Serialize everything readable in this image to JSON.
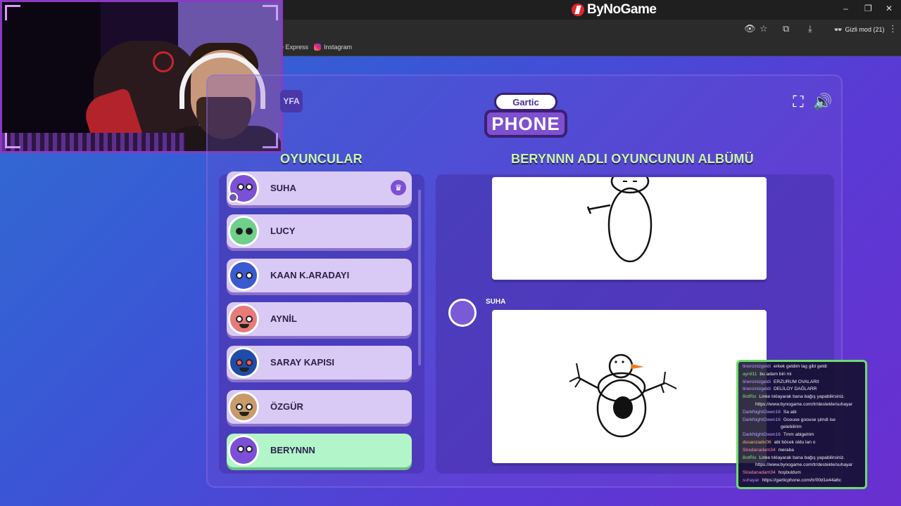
{
  "browser": {
    "brand": "ByNoGame",
    "incognito_label": "Gizli mod (21)",
    "bookmarks": [
      "e Express",
      "Instagram"
    ],
    "window_controls": [
      "–",
      "❐",
      "✕"
    ]
  },
  "game": {
    "left_button": "YFA",
    "logo_top": "Gartic",
    "logo_bottom": "PHONE",
    "players_title": "OYUNCULAR",
    "album_title": "BERYNNN ADLI OYUNCUNUN ALBÜMÜ",
    "players": [
      {
        "name": "SUHA",
        "avatar_color": "#7b4fd6",
        "host": true
      },
      {
        "name": "LUCY",
        "avatar_color": "#6fd08a",
        "host": false
      },
      {
        "name": "KAAN K.ARADAYI",
        "avatar_color": "#3a5ad0",
        "host": false
      },
      {
        "name": "AYNİL",
        "avatar_color": "#e87a7a",
        "host": false
      },
      {
        "name": "SARAY KAPISI",
        "avatar_color": "#1f4ca8",
        "host": false
      },
      {
        "name": "ÖZGÜR",
        "avatar_color": "#c99a6a",
        "host": false
      },
      {
        "name": "BERYNNN",
        "avatar_color": "#7b4fd6",
        "host": false,
        "active": true
      }
    ],
    "album_entry_author": "SUHA"
  },
  "chat": {
    "lines": [
      {
        "user": "tinercinizgeldi",
        "text": "erkek geldim lag gibi geldi",
        "color": "#b9a0ff"
      },
      {
        "user": "aynil11",
        "text": "bu adam biri mi",
        "color": "#7de07d"
      },
      {
        "user": "tinercinizgeldi",
        "text": "ERZURUM OVALARII",
        "color": "#b9a0ff"
      },
      {
        "user": "tinercinizgeldi",
        "text": "DELİLOY DAĞLARR",
        "color": "#b9a0ff"
      },
      {
        "user": "BotRix",
        "text": "Linke tıklayarak bana bağış yapabilirsiniz.",
        "color": "#7de07d"
      },
      {
        "user": "",
        "text": "https://www.bynogame.com/tr/destekle/suhayar",
        "color": "#7de07d"
      },
      {
        "user": "DarkNightOwen16",
        "text": "Sa abi",
        "color": "#b9a0ff"
      },
      {
        "user": "DarkNightOwen16",
        "text": "Goouse goouse şimdi ise",
        "color": "#b9a0ff"
      },
      {
        "user": "",
        "text": "gelebilirim",
        "color": "#b9a0ff"
      },
      {
        "user": "DarkNightOwen16",
        "text": "Tmm abigelrim",
        "color": "#b9a0ff"
      },
      {
        "user": "dusanzadic06",
        "text": "abi böcek oldu lan o",
        "color": "#ffb36b"
      },
      {
        "user": "Siradanadam34",
        "text": "meraba",
        "color": "#ff8ab1"
      },
      {
        "user": "BotRix",
        "text": "Linke tıklayarak bana bağış yapabilirsiniz.",
        "color": "#7de07d"
      },
      {
        "user": "",
        "text": "https://www.bynogame.com/tr/destekle/suhayar",
        "color": "#7de07d"
      },
      {
        "user": "Siradanadam34",
        "text": "hoşbuldum",
        "color": "#ff8ab1"
      },
      {
        "user": "suhayar",
        "text": "https://garticphone.com/tr/00d1e44a6c",
        "color": "#b98cff"
      }
    ]
  }
}
